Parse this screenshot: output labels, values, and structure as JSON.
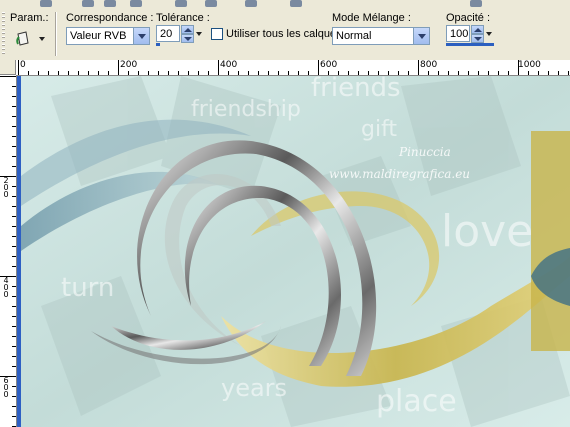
{
  "options": {
    "param_label": "Param.:",
    "correspondance_label": "Correspondance :",
    "correspondance_value": "Valeur RVB",
    "tolerance_label": "Tolérance :",
    "tolerance_value": "20",
    "use_all_layers_label": "Utiliser tous les calques",
    "blend_mode_label": "Mode Mélange :",
    "blend_mode_value": "Normal",
    "opacity_label": "Opacité :",
    "opacity_value": "100"
  },
  "ruler": {
    "top_labels": [
      "0",
      "200",
      "400",
      "600",
      "800",
      "1000"
    ],
    "left_labels": [
      "2\n0\n0",
      "4\n0\n0",
      "6\n0\n0"
    ]
  },
  "canvas": {
    "watermark_line1": "Pinuccia",
    "watermark_line2": "www.maldiregrafica.eu",
    "bg_words": [
      "friendship",
      "friends",
      "gift",
      "love",
      "place",
      "turn",
      "years"
    ]
  },
  "colors": {
    "accent_blue": "#2d5fc4",
    "canvas_bg": "#ccdfdc",
    "gold": "#c8b44a"
  }
}
